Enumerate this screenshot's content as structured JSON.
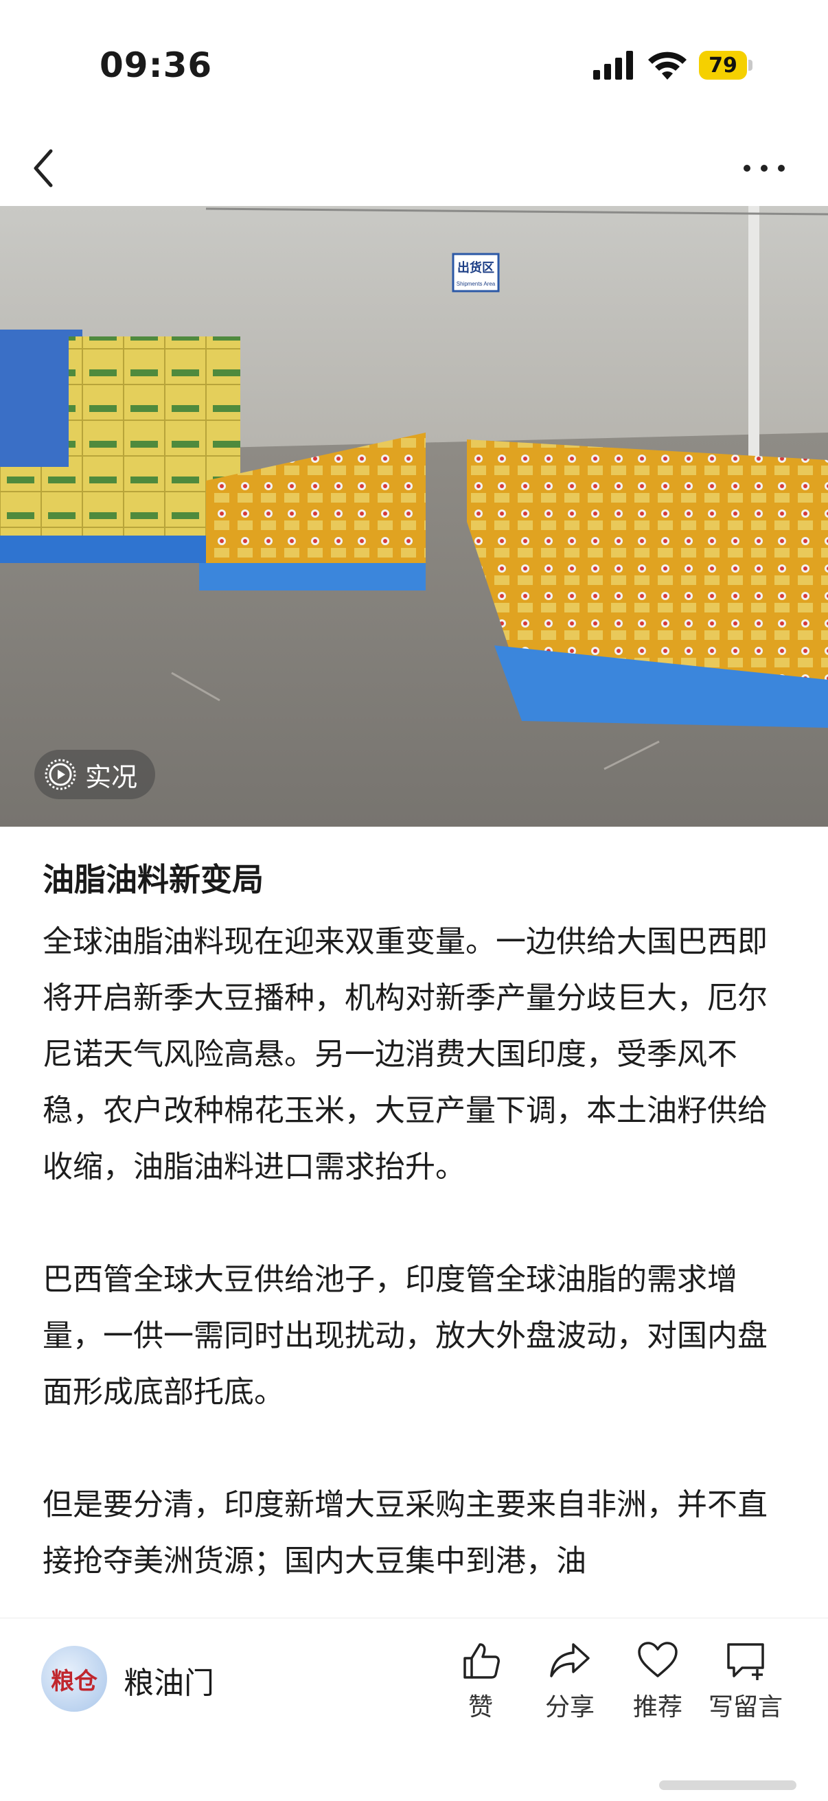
{
  "status_bar": {
    "time": "09:36",
    "battery": "79",
    "battery_color": "#f5d000"
  },
  "nav": {
    "back_icon": "chevron-left-icon",
    "more_icon": "more-horizontal-icon"
  },
  "photo": {
    "sign_text": "出货区",
    "sign_subtext": "Shipments Area",
    "live_label": "实况"
  },
  "article": {
    "title": "油脂油料新变局",
    "paragraphs": [
      "全球油脂油料现在迎来双重变量。一边供给大国巴西即将开启新季大豆播种，机构对新季产量分歧巨大，厄尔尼诺天气风险高悬。另一边消费大国印度，受季风不稳，农户改种棉花玉米，大豆产量下调，本土油籽供给收缩，油脂油料进口需求抬升。",
      "巴西管全球大豆供给池子，印度管全球油脂的需求增量，一供一需同时出现扰动，放大外盘波动，对国内盘面形成底部托底。",
      "但是要分清，印度新增大豆采购主要来自非洲，并不直接抢夺美洲货源；国内大豆集中到港，油"
    ]
  },
  "bottom_bar": {
    "avatar_text": "粮仓",
    "author_name": "粮油门",
    "actions": [
      {
        "label": "赞",
        "icon": "thumbs-up-icon"
      },
      {
        "label": "分享",
        "icon": "share-icon"
      },
      {
        "label": "推荐",
        "icon": "heart-icon"
      },
      {
        "label": "写留言",
        "icon": "comment-add-icon"
      }
    ]
  }
}
